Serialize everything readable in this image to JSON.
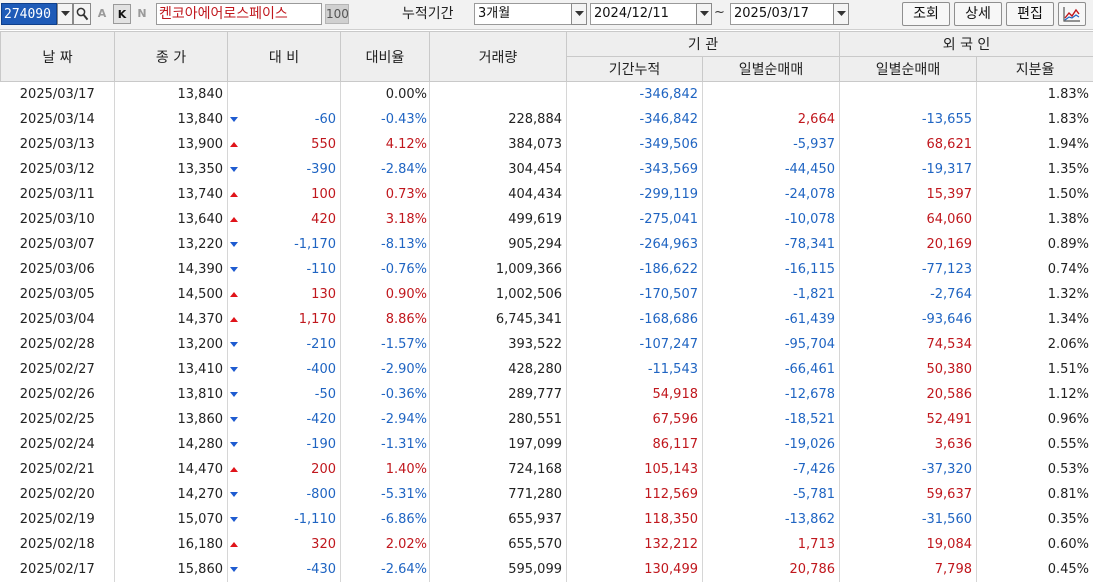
{
  "toolbar": {
    "code": "274090",
    "stock_name": "켄코아에어로스페이스",
    "badge": "100",
    "btn_a": "A",
    "btn_k": "K",
    "btn_n": "N",
    "period_label": "누적기간",
    "period_value": "3개월",
    "start_date": "2024/12/11",
    "tilde": "~",
    "end_date": "2025/03/17",
    "query_label": "조회",
    "detail_label": "상세",
    "edit_label": "편집"
  },
  "headers": {
    "date": "날 짜",
    "close": "종 가",
    "change": "대 비",
    "ratio": "대비율",
    "volume": "거래량",
    "institution": "기 관",
    "inst_cum": "기간누적",
    "inst_daily": "일별순매매",
    "foreign": "외 국 인",
    "for_daily": "일별순매매",
    "for_share": "지분율"
  },
  "colors": {
    "up": "#c0171d",
    "down": "#1f64c2",
    "code_bg": "#1e5bb8"
  },
  "rows": [
    {
      "date": "2025/03/17",
      "close": "13,840",
      "dir": "none",
      "change": "",
      "ratio": "0.00%",
      "volume": "",
      "inst_cum": "-346,842",
      "inst_daily": "",
      "for_daily": "",
      "for_share": "1.83%"
    },
    {
      "date": "2025/03/14",
      "close": "13,840",
      "dir": "down",
      "change": "-60",
      "ratio": "-0.43%",
      "volume": "228,884",
      "inst_cum": "-346,842",
      "inst_daily": "2,664",
      "for_daily": "-13,655",
      "for_share": "1.83%"
    },
    {
      "date": "2025/03/13",
      "close": "13,900",
      "dir": "up",
      "change": "550",
      "ratio": "4.12%",
      "volume": "384,073",
      "inst_cum": "-349,506",
      "inst_daily": "-5,937",
      "for_daily": "68,621",
      "for_share": "1.94%"
    },
    {
      "date": "2025/03/12",
      "close": "13,350",
      "dir": "down",
      "change": "-390",
      "ratio": "-2.84%",
      "volume": "304,454",
      "inst_cum": "-343,569",
      "inst_daily": "-44,450",
      "for_daily": "-19,317",
      "for_share": "1.35%"
    },
    {
      "date": "2025/03/11",
      "close": "13,740",
      "dir": "up",
      "change": "100",
      "ratio": "0.73%",
      "volume": "404,434",
      "inst_cum": "-299,119",
      "inst_daily": "-24,078",
      "for_daily": "15,397",
      "for_share": "1.50%"
    },
    {
      "date": "2025/03/10",
      "close": "13,640",
      "dir": "up",
      "change": "420",
      "ratio": "3.18%",
      "volume": "499,619",
      "inst_cum": "-275,041",
      "inst_daily": "-10,078",
      "for_daily": "64,060",
      "for_share": "1.38%"
    },
    {
      "date": "2025/03/07",
      "close": "13,220",
      "dir": "down",
      "change": "-1,170",
      "ratio": "-8.13%",
      "volume": "905,294",
      "inst_cum": "-264,963",
      "inst_daily": "-78,341",
      "for_daily": "20,169",
      "for_share": "0.89%"
    },
    {
      "date": "2025/03/06",
      "close": "14,390",
      "dir": "down",
      "change": "-110",
      "ratio": "-0.76%",
      "volume": "1,009,366",
      "inst_cum": "-186,622",
      "inst_daily": "-16,115",
      "for_daily": "-77,123",
      "for_share": "0.74%"
    },
    {
      "date": "2025/03/05",
      "close": "14,500",
      "dir": "up",
      "change": "130",
      "ratio": "0.90%",
      "volume": "1,002,506",
      "inst_cum": "-170,507",
      "inst_daily": "-1,821",
      "for_daily": "-2,764",
      "for_share": "1.32%"
    },
    {
      "date": "2025/03/04",
      "close": "14,370",
      "dir": "up",
      "change": "1,170",
      "ratio": "8.86%",
      "volume": "6,745,341",
      "inst_cum": "-168,686",
      "inst_daily": "-61,439",
      "for_daily": "-93,646",
      "for_share": "1.34%"
    },
    {
      "date": "2025/02/28",
      "close": "13,200",
      "dir": "down",
      "change": "-210",
      "ratio": "-1.57%",
      "volume": "393,522",
      "inst_cum": "-107,247",
      "inst_daily": "-95,704",
      "for_daily": "74,534",
      "for_share": "2.06%"
    },
    {
      "date": "2025/02/27",
      "close": "13,410",
      "dir": "down",
      "change": "-400",
      "ratio": "-2.90%",
      "volume": "428,280",
      "inst_cum": "-11,543",
      "inst_daily": "-66,461",
      "for_daily": "50,380",
      "for_share": "1.51%"
    },
    {
      "date": "2025/02/26",
      "close": "13,810",
      "dir": "down",
      "change": "-50",
      "ratio": "-0.36%",
      "volume": "289,777",
      "inst_cum": "54,918",
      "inst_daily": "-12,678",
      "for_daily": "20,586",
      "for_share": "1.12%"
    },
    {
      "date": "2025/02/25",
      "close": "13,860",
      "dir": "down",
      "change": "-420",
      "ratio": "-2.94%",
      "volume": "280,551",
      "inst_cum": "67,596",
      "inst_daily": "-18,521",
      "for_daily": "52,491",
      "for_share": "0.96%"
    },
    {
      "date": "2025/02/24",
      "close": "14,280",
      "dir": "down",
      "change": "-190",
      "ratio": "-1.31%",
      "volume": "197,099",
      "inst_cum": "86,117",
      "inst_daily": "-19,026",
      "for_daily": "3,636",
      "for_share": "0.55%"
    },
    {
      "date": "2025/02/21",
      "close": "14,470",
      "dir": "up",
      "change": "200",
      "ratio": "1.40%",
      "volume": "724,168",
      "inst_cum": "105,143",
      "inst_daily": "-7,426",
      "for_daily": "-37,320",
      "for_share": "0.53%"
    },
    {
      "date": "2025/02/20",
      "close": "14,270",
      "dir": "down",
      "change": "-800",
      "ratio": "-5.31%",
      "volume": "771,280",
      "inst_cum": "112,569",
      "inst_daily": "-5,781",
      "for_daily": "59,637",
      "for_share": "0.81%"
    },
    {
      "date": "2025/02/19",
      "close": "15,070",
      "dir": "down",
      "change": "-1,110",
      "ratio": "-6.86%",
      "volume": "655,937",
      "inst_cum": "118,350",
      "inst_daily": "-13,862",
      "for_daily": "-31,560",
      "for_share": "0.35%"
    },
    {
      "date": "2025/02/18",
      "close": "16,180",
      "dir": "up",
      "change": "320",
      "ratio": "2.02%",
      "volume": "655,570",
      "inst_cum": "132,212",
      "inst_daily": "1,713",
      "for_daily": "19,084",
      "for_share": "0.60%"
    },
    {
      "date": "2025/02/17",
      "close": "15,860",
      "dir": "down",
      "change": "-430",
      "ratio": "-2.64%",
      "volume": "595,099",
      "inst_cum": "130,499",
      "inst_daily": "20,786",
      "for_daily": "7,798",
      "for_share": "0.45%"
    }
  ]
}
